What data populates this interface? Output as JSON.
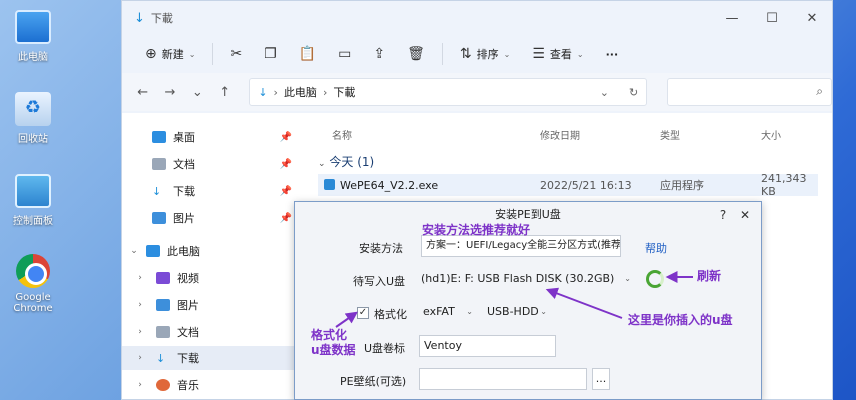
{
  "desktop": {
    "icons": [
      {
        "label": "此电脑",
        "icon": "computer-icon"
      },
      {
        "label": "回收站",
        "icon": "recycle-bin-icon"
      },
      {
        "label": "控制面板",
        "icon": "control-panel-icon"
      },
      {
        "label": "Google Chrome",
        "icon": "chrome-icon"
      }
    ]
  },
  "explorer": {
    "title": "下載",
    "toolbar": {
      "new": "新建",
      "sort": "排序",
      "view": "查看",
      "more": "···"
    },
    "address": {
      "crumb1": "此电脑",
      "crumb2": "下載"
    },
    "search": {
      "placeholder": ""
    },
    "nav": {
      "quick": [
        {
          "label": "桌面"
        },
        {
          "label": "文档"
        },
        {
          "label": "下载"
        },
        {
          "label": "图片"
        }
      ],
      "this_pc": "此电脑",
      "pc_items": [
        {
          "label": "视频"
        },
        {
          "label": "图片"
        },
        {
          "label": "文档"
        },
        {
          "label": "下载"
        },
        {
          "label": "音乐"
        }
      ]
    },
    "columns": {
      "name": "名称",
      "date": "修改日期",
      "type": "类型",
      "size": "大小"
    },
    "group": "今天 (1)",
    "files": [
      {
        "name": "WePE64_V2.2.exe",
        "date": "2022/5/21 16:13",
        "type": "应用程序",
        "size": "241,343 KB"
      }
    ]
  },
  "dialog": {
    "title": "安装PE到U盘",
    "method_label": "安装方法",
    "method_value": "方案一：UEFI/Legacy全能三分区方式(推荐)",
    "help": "帮助",
    "disk_label": "待写入U盘",
    "disk_value": "(hd1)E: F: USB Flash DISK (30.2GB)",
    "format_label": "格式化",
    "format_check": "✓",
    "fs_value": "exFAT",
    "mode_value": "USB-HDD",
    "vol_label": "U盘卷标",
    "vol_value": "Ventoy",
    "wallpaper_label": "PE壁纸(可选)",
    "browse": "...",
    "help_button": "?",
    "close_button": "✕"
  },
  "annotations": {
    "method_tip": "安装方法选推荐就好",
    "refresh_tip": "刷新",
    "disk_tip": "这里是你插入的u盘",
    "format_tip_line1": "格式化",
    "format_tip_line2": "u盘数据"
  },
  "colors": {
    "annotation": "#7e33c8",
    "link": "#2260c4",
    "accent": "#1d7ad8"
  }
}
